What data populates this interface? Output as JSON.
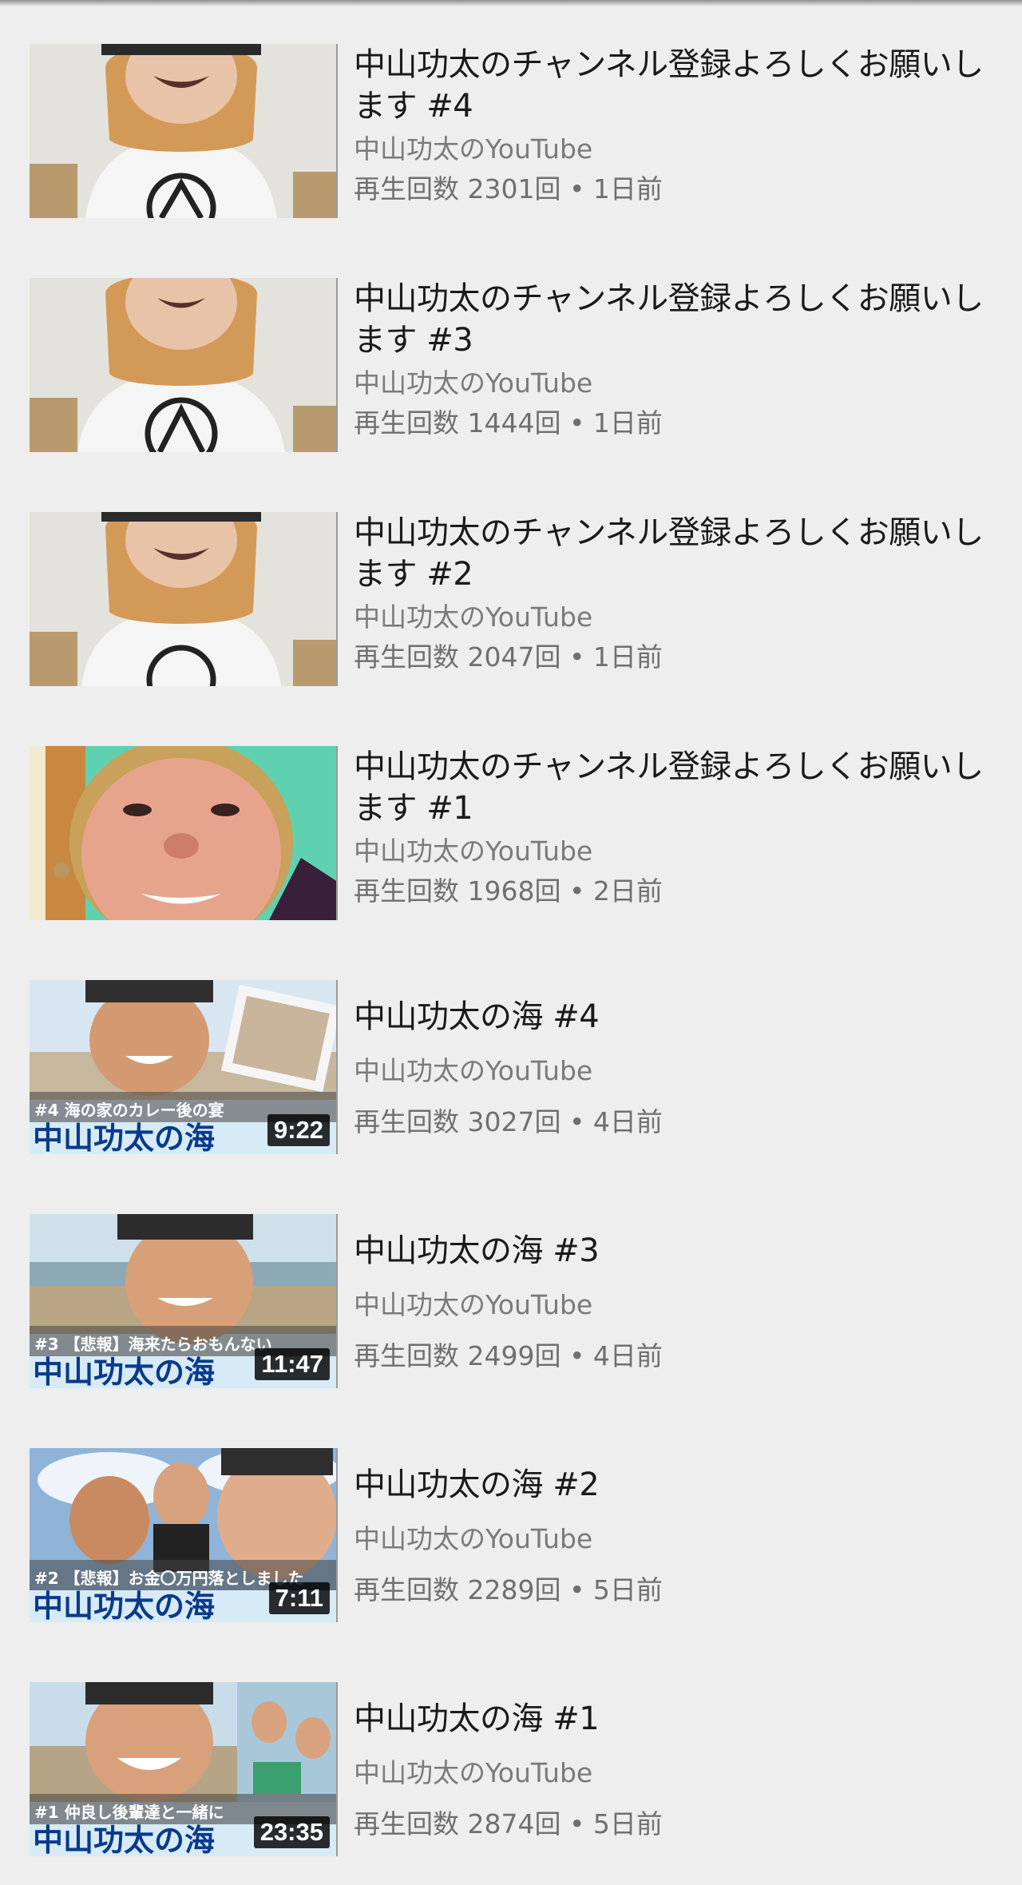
{
  "videos": [
    {
      "title": "中山功太のチャンネル登録よろしくお願いします #4",
      "channel": "中山功太のYouTube",
      "meta": "再生回数 2301回 • 1日前",
      "duration": "",
      "thumb_icon": "person-selfie-thumbnail"
    },
    {
      "title": "中山功太のチャンネル登録よろしくお願いします #3",
      "channel": "中山功太のYouTube",
      "meta": "再生回数 1444回 • 1日前",
      "duration": "",
      "thumb_icon": "person-selfie-thumbnail"
    },
    {
      "title": "中山功太のチャンネル登録よろしくお願いします #2",
      "channel": "中山功太のYouTube",
      "meta": "再生回数 2047回 • 1日前",
      "duration": "",
      "thumb_icon": "person-selfie-thumbnail"
    },
    {
      "title": "中山功太のチャンネル登録よろしくお願いします #1",
      "channel": "中山功太のYouTube",
      "meta": "再生回数 1968回 • 2日前",
      "duration": "",
      "thumb_icon": "face-closeup-thumbnail"
    },
    {
      "title": "中山功太の海 #4",
      "channel": "中山功太のYouTube",
      "meta": "再生回数 3027回 • 4日前",
      "duration": "9:22",
      "thumb_caption": "#4 海の家のカレー後の宴",
      "thumb_banner": "中山功太の海",
      "thumb_icon": "beach-thumbnail"
    },
    {
      "title": "中山功太の海 #3",
      "channel": "中山功太のYouTube",
      "meta": "再生回数 2499回 • 4日前",
      "duration": "11:47",
      "thumb_caption": "#3 【悲報】海来たらおもんない",
      "thumb_banner": "中山功太の海",
      "thumb_icon": "beach-thumbnail"
    },
    {
      "title": "中山功太の海 #2",
      "channel": "中山功太のYouTube",
      "meta": "再生回数 2289回 • 5日前",
      "duration": "7:11",
      "thumb_caption": "#2 【悲報】お金〇万円落としました",
      "thumb_banner": "中山功太の海",
      "thumb_icon": "beach-thumbnail"
    },
    {
      "title": "中山功太の海 #1",
      "channel": "中山功太のYouTube",
      "meta": "再生回数 2874回 • 5日前",
      "duration": "23:35",
      "thumb_caption": "#1 仲良し後輩達と一緒に",
      "thumb_banner": "中山功太の海",
      "thumb_icon": "beach-thumbnail"
    }
  ],
  "colors": {
    "background": "#eeeeee",
    "title": "#1a1a1a",
    "secondary": "#7a7a7a",
    "duration_bg": "#000000",
    "banner_text": "#0a3a8a"
  }
}
